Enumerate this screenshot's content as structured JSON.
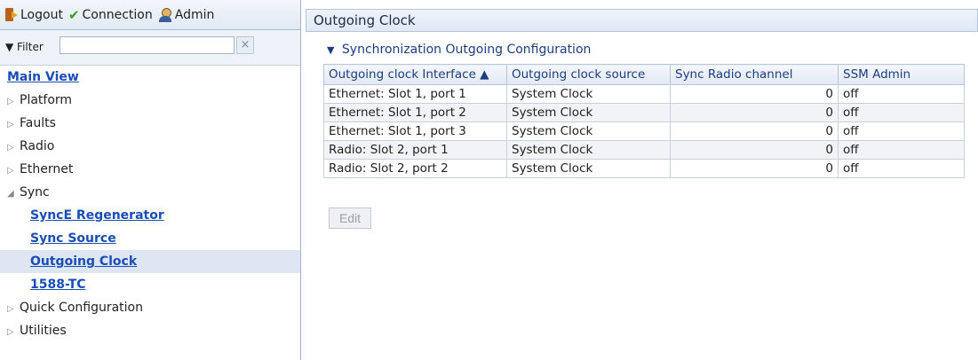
{
  "toolbar": {
    "logout_label": "Logout",
    "connection_label": "Connection",
    "admin_label": "Admin",
    "icons": [
      "logout-icon",
      "check-icon",
      "admin-icon"
    ]
  },
  "filter": {
    "label": "▼ Filter",
    "value": "",
    "clear_symbol": "×"
  },
  "tree": {
    "items": [
      {
        "label": "Main View",
        "type": "link",
        "expander": ""
      },
      {
        "label": "Platform",
        "type": "node",
        "expander": "▷"
      },
      {
        "label": "Faults",
        "type": "node",
        "expander": "▷"
      },
      {
        "label": "Radio",
        "type": "node",
        "expander": "▷"
      },
      {
        "label": "Ethernet",
        "type": "node",
        "expander": "▷"
      },
      {
        "label": "Sync",
        "type": "node",
        "expander": "◢"
      },
      {
        "label": "SyncE Regenerator",
        "type": "link",
        "expander": ""
      },
      {
        "label": "Sync Source",
        "type": "link",
        "expander": ""
      },
      {
        "label": "Outgoing Clock",
        "type": "link",
        "expander": "",
        "selected": true
      },
      {
        "label": "1588-TC",
        "type": "link",
        "expander": ""
      },
      {
        "label": "Quick Configuration",
        "type": "node",
        "expander": "▷"
      },
      {
        "label": "Utilities",
        "type": "node",
        "expander": "▷"
      }
    ]
  },
  "page": {
    "title": "Outgoing Clock",
    "section_title": "Synchronization Outgoing Configuration",
    "section_expander": "▼"
  },
  "table": {
    "columns": [
      "Outgoing clock Interface ▲",
      "Outgoing clock source",
      "Sync Radio channel",
      "SSM Admin"
    ],
    "rows": [
      [
        "Ethernet: Slot 1, port 1",
        "System Clock",
        "0",
        "off"
      ],
      [
        "Ethernet: Slot 1, port 2",
        "System Clock",
        "0",
        "off"
      ],
      [
        "Ethernet: Slot 1, port 3",
        "System Clock",
        "0",
        "off"
      ],
      [
        "Radio: Slot 2, port 1",
        "System Clock",
        "0",
        "off"
      ],
      [
        "Radio: Slot 2, port 2",
        "System Clock",
        "0",
        "off"
      ]
    ]
  },
  "actions": {
    "edit_label": "Edit"
  },
  "colors": {
    "link": "#1a4db7",
    "header_text": "#1d3d80",
    "selected_row": "#dde6f2"
  }
}
